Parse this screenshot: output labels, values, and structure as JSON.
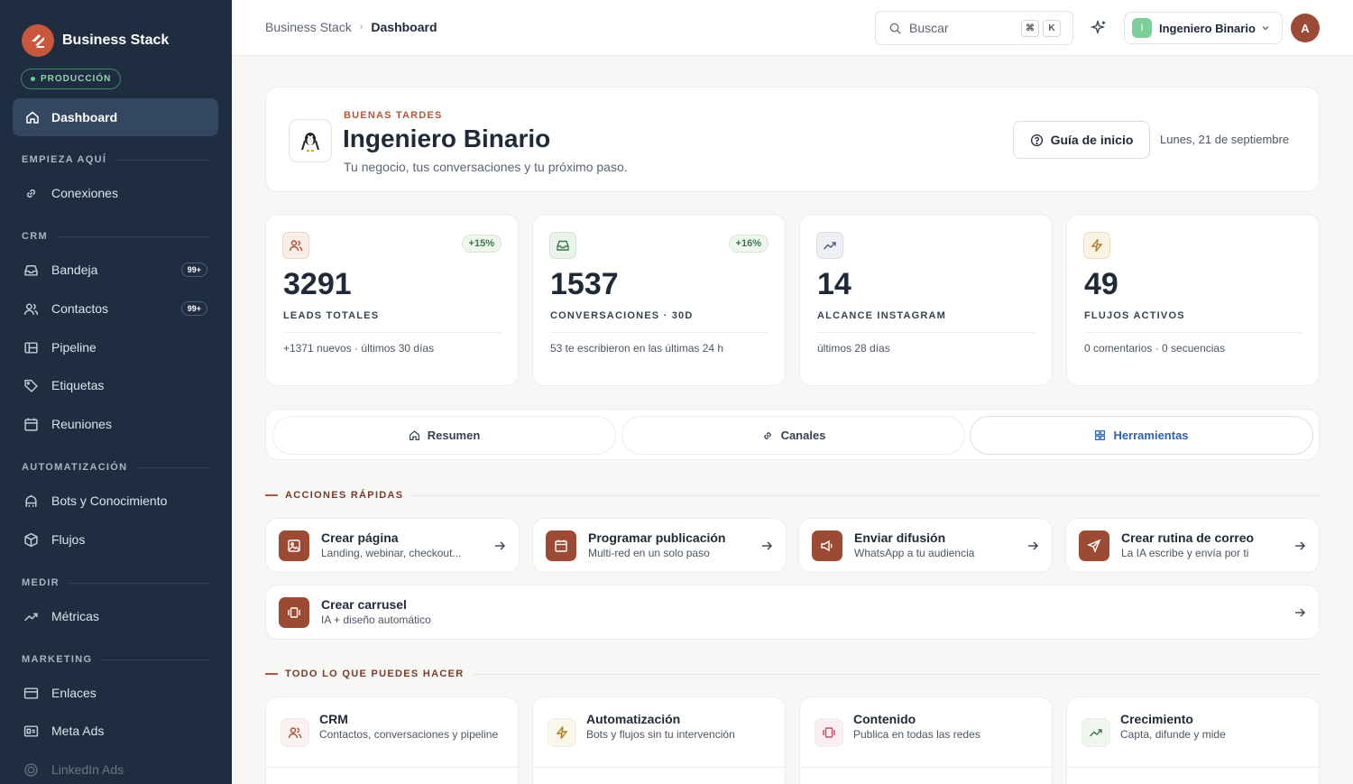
{
  "sidebar": {
    "brand": "Business Stack",
    "env_badge": "PRODUCCIÓN",
    "active_item": "Dashboard",
    "sections": {
      "empieza": "EMPIEZA AQUÍ",
      "crm": "CRM",
      "automatizacion": "AUTOMATIZACIÓN",
      "medir": "MEDIR",
      "marketing": "MARKETING"
    },
    "items": {
      "conexiones": "Conexiones",
      "bandeja": "Bandeja",
      "bandeja_badge": "99+",
      "contactos": "Contactos",
      "contactos_badge": "99+",
      "pipeline": "Pipeline",
      "etiquetas": "Etiquetas",
      "reuniones": "Reuniones",
      "bots": "Bots y Conocimiento",
      "flujos": "Flujos",
      "metricas": "Métricas",
      "enlaces": "Enlaces",
      "meta_ads": "Meta Ads",
      "linkedin_ads": "LinkedIn Ads"
    }
  },
  "topbar": {
    "breadcrumb_root": "Business Stack",
    "breadcrumb_sep": "›",
    "breadcrumb_current": "Dashboard",
    "search_placeholder": "Buscar",
    "shortcut_1": "⌘",
    "shortcut_2": "K",
    "workspace_initial": "I",
    "workspace_name": "Ingeniero Binario",
    "avatar_initial": "A"
  },
  "hero": {
    "greeting": "BUENAS TARDES",
    "name": "Ingeniero Binario",
    "subtitle": "Tu negocio, tus conversaciones y tu próximo paso.",
    "guide_button": "Guía de inicio",
    "date": "Lunes, 21 de septiembre"
  },
  "stats": [
    {
      "value": "3291",
      "label": "LEADS TOTALES",
      "delta": "+15%",
      "note": "+1371 nuevos · últimos 30 días",
      "icon": "users-icon",
      "color": "#f8ede9"
    },
    {
      "value": "1537",
      "label": "CONVERSACIONES · 30D",
      "delta": "+16%",
      "note": "53 te escribieron en las últimas 24 h",
      "icon": "inbox-icon",
      "color": "#eaf4ec"
    },
    {
      "value": "14",
      "label": "ALCANCE INSTAGRAM",
      "delta": "",
      "note": "últimos 28 días",
      "icon": "trending-icon",
      "color": "#eef0f5"
    },
    {
      "value": "49",
      "label": "FLUJOS ACTIVOS",
      "delta": "",
      "note": "0 comentarios · 0 secuencias",
      "icon": "bolt-icon",
      "color": "#fbf3e4"
    }
  ],
  "tabs": [
    {
      "label": "Resumen",
      "icon": "home-icon"
    },
    {
      "label": "Canales",
      "icon": "link-icon"
    },
    {
      "label": "Herramientas",
      "icon": "grid-icon",
      "active": true
    }
  ],
  "quick_actions": {
    "heading": "ACCIONES RÁPIDAS",
    "items": [
      {
        "title": "Crear página",
        "subtitle": "Landing, webinar, checkout...",
        "icon": "image-icon"
      },
      {
        "title": "Programar publicación",
        "subtitle": "Multi-red en un solo paso",
        "icon": "calendar-icon"
      },
      {
        "title": "Enviar difusión",
        "subtitle": "WhatsApp a tu audiencia",
        "icon": "megaphone-icon"
      },
      {
        "title": "Crear rutina de correo",
        "subtitle": "La IA escribe y envía por ti",
        "icon": "send-icon"
      },
      {
        "title": "Crear carrusel",
        "subtitle": "IA + diseño automático",
        "icon": "carousel-icon"
      }
    ]
  },
  "features": {
    "heading": "TODO LO QUE PUEDES HACER",
    "items": [
      {
        "title": "CRM",
        "subtitle": "Contactos, conversaciones y pipeline",
        "icon": "users-icon"
      },
      {
        "title": "Automatización",
        "subtitle": "Bots y flujos sin tu intervención",
        "icon": "bolt-icon"
      },
      {
        "title": "Contenido",
        "subtitle": "Publica en todas las redes",
        "icon": "carousel-icon"
      },
      {
        "title": "Crecimiento",
        "subtitle": "Capta, difunde y mide",
        "icon": "trending-icon"
      }
    ]
  },
  "colors": {
    "sidebar_bg": "#1e2d40",
    "accent": "#9c4a33",
    "active_tab": "#2f62b3",
    "success": "#3a7a4a"
  }
}
